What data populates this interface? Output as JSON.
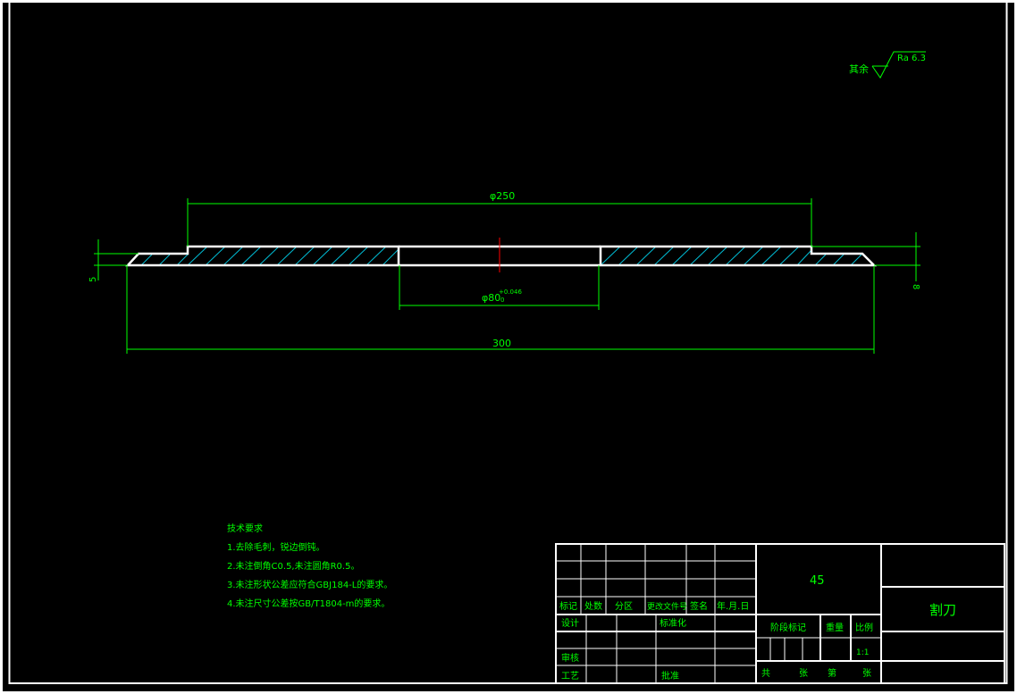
{
  "surface_finish": {
    "prefix": "其余",
    "value": "Ra 6.3"
  },
  "dimensions": {
    "phi250": "φ250",
    "phi80": "φ80",
    "phi80_tol_upper": "+0.046",
    "phi80_tol_lower": "0",
    "length300": "300",
    "left_thickness": "5",
    "right_thickness": "8"
  },
  "tech_requirements": {
    "heading": "技术要求",
    "items": [
      "1.去除毛刺，锐边倒钝。",
      "2.未注倒角C0.5,未注圆角R0.5。",
      "3.未注形状公差应符合GBJ184-L的要求。",
      "4.未注尺寸公差按GB/T1804-m的要求。"
    ]
  },
  "title_block": {
    "material": "45",
    "part_name": "割刀",
    "header_labels": [
      "标记",
      "处数",
      "分区",
      "更改文件号",
      "签名",
      "年.月.日"
    ],
    "design": "设计",
    "standardize": "标准化",
    "review": "审核",
    "process": "工艺",
    "approve": "批准",
    "stage_mark": "阶段标记",
    "weight": "重量",
    "scale": "比例",
    "scale_value": "1:1",
    "total": "共",
    "sheet_unit1": "张",
    "sheet_no": "第",
    "sheet_unit2": "张"
  }
}
